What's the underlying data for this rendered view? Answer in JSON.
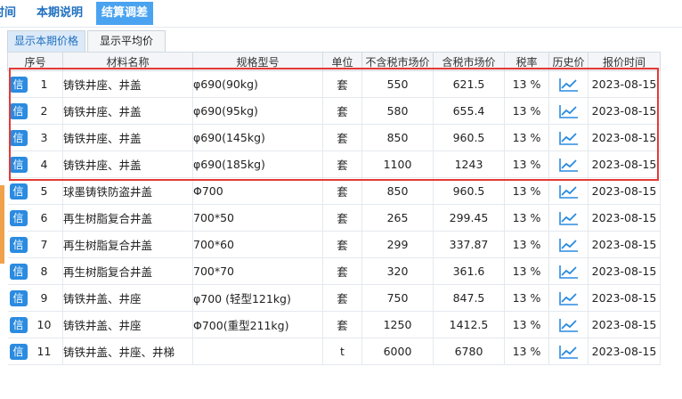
{
  "top_tabs": [
    {
      "label": "时间",
      "active": false
    },
    {
      "label": "本期说明",
      "active": false
    },
    {
      "label": "结算调差",
      "active": true
    }
  ],
  "sub_tabs": [
    {
      "label": "显示本期价格",
      "active": true
    },
    {
      "label": "显示平均价",
      "active": false
    }
  ],
  "table": {
    "headers": [
      "序号",
      "材料名称",
      "规格型号",
      "单位",
      "不含税市场价",
      "含税市场价",
      "税率",
      "历史价",
      "报价时间"
    ],
    "badge_label": "信",
    "rows": [
      {
        "no": "1",
        "name": "铸铁井座、井盖",
        "spec": "φ690(90kg)",
        "unit": "套",
        "price_ex": "550",
        "price_in": "621.5",
        "tax": "13 %",
        "date": "2023-08-15"
      },
      {
        "no": "2",
        "name": "铸铁井座、井盖",
        "spec": "φ690(95kg)",
        "unit": "套",
        "price_ex": "580",
        "price_in": "655.4",
        "tax": "13 %",
        "date": "2023-08-15"
      },
      {
        "no": "3",
        "name": "铸铁井座、井盖",
        "spec": "φ690(145kg)",
        "unit": "套",
        "price_ex": "850",
        "price_in": "960.5",
        "tax": "13 %",
        "date": "2023-08-15"
      },
      {
        "no": "4",
        "name": "铸铁井座、井盖",
        "spec": "φ690(185kg)",
        "unit": "套",
        "price_ex": "1100",
        "price_in": "1243",
        "tax": "13 %",
        "date": "2023-08-15"
      },
      {
        "no": "5",
        "name": "球墨铸铁防盗井盖",
        "spec": "Φ700",
        "unit": "套",
        "price_ex": "850",
        "price_in": "960.5",
        "tax": "13 %",
        "date": "2023-08-15"
      },
      {
        "no": "6",
        "name": "再生树脂复合井盖",
        "spec": "700*50",
        "unit": "套",
        "price_ex": "265",
        "price_in": "299.45",
        "tax": "13 %",
        "date": "2023-08-15"
      },
      {
        "no": "7",
        "name": "再生树脂复合井盖",
        "spec": "700*60",
        "unit": "套",
        "price_ex": "299",
        "price_in": "337.87",
        "tax": "13 %",
        "date": "2023-08-15"
      },
      {
        "no": "8",
        "name": "再生树脂复合井盖",
        "spec": "700*70",
        "unit": "套",
        "price_ex": "320",
        "price_in": "361.6",
        "tax": "13 %",
        "date": "2023-08-15"
      },
      {
        "no": "9",
        "name": "铸铁井盖、井座",
        "spec": "φ700 (轻型121kg)",
        "unit": "套",
        "price_ex": "750",
        "price_in": "847.5",
        "tax": "13 %",
        "date": "2023-08-15"
      },
      {
        "no": "10",
        "name": "铸铁井盖、井座",
        "spec": "Φ700(重型211kg)",
        "unit": "套",
        "price_ex": "1250",
        "price_in": "1412.5",
        "tax": "13 %",
        "date": "2023-08-15"
      },
      {
        "no": "11",
        "name": "铸铁井盖、井座、井梯",
        "spec": "",
        "unit": "t",
        "price_ex": "6000",
        "price_in": "6780",
        "tax": "13 %",
        "date": "2023-08-15"
      }
    ]
  },
  "colors": {
    "accent": "#4aa3f0",
    "badge": "#2a8be0",
    "highlight": "#e53935"
  },
  "icons": {
    "history": "trend-chart-icon"
  }
}
